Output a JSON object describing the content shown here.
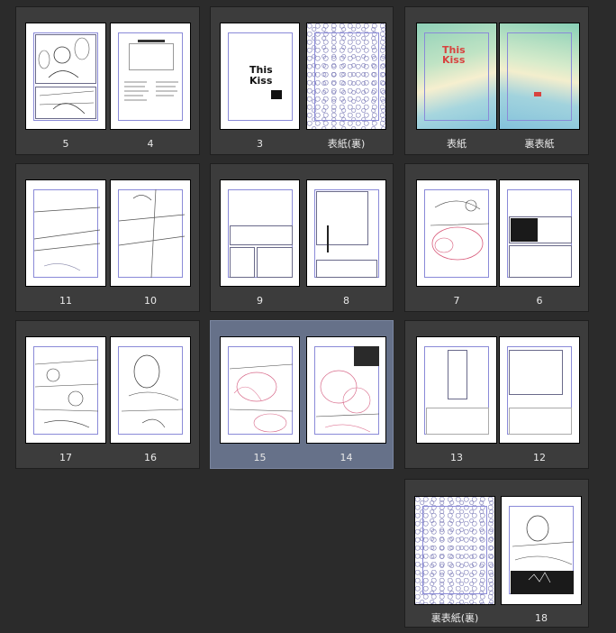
{
  "page_labels": {
    "p5": "5",
    "p4": "4",
    "p3": "3",
    "p_back_inner_1": "表紙(裏)",
    "p_cover": "表紙",
    "p_back_cover": "裏表紙",
    "p11": "11",
    "p10": "10",
    "p9": "9",
    "p8": "8",
    "p7": "7",
    "p6": "6",
    "p17": "17",
    "p16": "16",
    "p15": "15",
    "p14": "14",
    "p13": "13",
    "p12": "12",
    "p_back_inner_2": "裏表紙(裏)",
    "p18": "18"
  },
  "cover_text": {
    "title_line1": "This",
    "title_line2": "Kiss"
  },
  "selected_spread": "15-14",
  "colors": {
    "background": "#2b2b2b",
    "spread_bg": "#3c3c3c",
    "selected_bg": "#667189",
    "guide": "#8a8ad8",
    "cover_red": "#d8433f"
  }
}
